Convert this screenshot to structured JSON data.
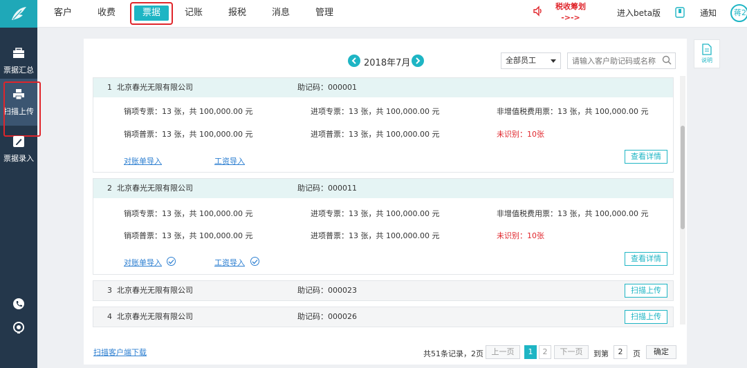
{
  "colors": {
    "accent": "#1eb5c4",
    "sidebar": "#24374b",
    "alert": "#e0252b",
    "link": "#2d7fd1"
  },
  "sidebar": {
    "items": [
      {
        "label": "票据汇总",
        "icon": "briefcase-icon"
      },
      {
        "label": "扫描上传",
        "icon": "printer-icon",
        "active": true
      },
      {
        "label": "票据录入",
        "icon": "edit-icon"
      }
    ],
    "bottom_icons": [
      "phone-icon",
      "headset-icon"
    ]
  },
  "topnav": {
    "tabs": [
      {
        "label": "客户"
      },
      {
        "label": "收费"
      },
      {
        "label": "票据",
        "active": true
      },
      {
        "label": "记账"
      },
      {
        "label": "报税"
      },
      {
        "label": "消息"
      },
      {
        "label": "管理"
      }
    ],
    "tax_plan_label": "税收筹划",
    "tax_plan_arrow": "->->",
    "beta_label": "进入beta版",
    "notice_label": "通知",
    "avatar_text": "蒋2"
  },
  "filters": {
    "month": "2018年7月",
    "employee": "全部员工",
    "search_placeholder": "请输入客户助记码或名称"
  },
  "help_label": "说明",
  "labels": {
    "code_prefix": "助记码：",
    "statement_import": "对账单导入",
    "salary_import": "工资导入",
    "view_details": "查看详情",
    "scan_upload": "扫描上传"
  },
  "companies": [
    {
      "index": "1",
      "name": "北京春光无限有限公司",
      "code": "000001",
      "sales_special": "销项专票：13 张，共 100,000.00 元",
      "input_special": "进项专票：13 张，共 100,000.00 元",
      "non_vat": "非增值税费用票：13 张，共 100,000.00 元",
      "sales_normal": "销项普票：13 张，共 100,000.00 元",
      "input_normal": "进项普票：13 张，共 100,000.00 元",
      "unrecognized": "未识别：10张"
    },
    {
      "index": "2",
      "name": "北京春光无限有限公司",
      "code": "000011",
      "sales_special": "销项专票：13 张，共 100,000.00 元",
      "input_special": "进项专票：13 张，共 100,000.00 元",
      "non_vat": "非增值税费用票：13 张，共 100,000.00 元",
      "sales_normal": "销项普票：13 张，共 100,000.00 元",
      "input_normal": "进项普票：13 张，共 100,000.00 元",
      "unrecognized": "未识别：10张"
    },
    {
      "index": "3",
      "name": "北京春光无限有限公司",
      "code": "000023"
    },
    {
      "index": "4",
      "name": "北京春光无限有限公司",
      "code": "000026"
    }
  ],
  "footer": {
    "download_link": "扫描客户端下载",
    "records": "共51条记录，2页",
    "prev": "上一页",
    "next": "下一页",
    "page1": "1",
    "page2": "2",
    "goto_label": "到第",
    "goto_value": "2",
    "page_unit": "页",
    "confirm": "确定"
  }
}
